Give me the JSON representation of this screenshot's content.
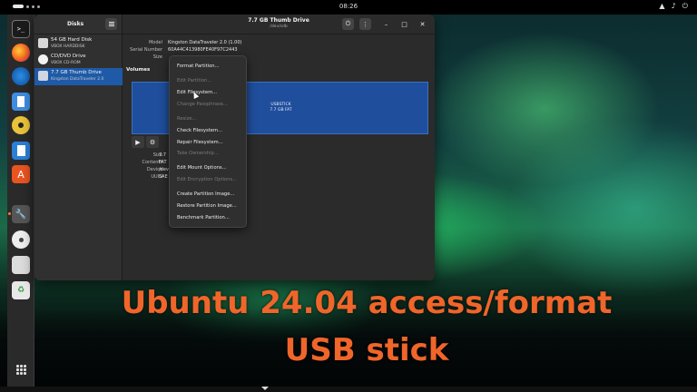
{
  "topbar": {
    "clock": "08:26",
    "tray_icons": [
      "network-icon",
      "volume-icon",
      "power-icon"
    ]
  },
  "dock": {
    "items": [
      "terminal-icon",
      "firefox-icon",
      "thunderbird-icon",
      "notes-icon",
      "rhythmbox-icon",
      "writer-icon",
      "app-center-icon",
      "disks-icon",
      "optical-disc-icon",
      "drive-icon",
      "trash-icon"
    ],
    "active": "disks-icon"
  },
  "sidebar": {
    "title": "Disks",
    "drives": [
      {
        "name": "54 GB Hard Disk",
        "sub": "VBOX HARDDISK"
      },
      {
        "name": "CD/DVD Drive",
        "sub": "VBOX CD-ROM"
      },
      {
        "name": "7.7 GB Thumb Drive",
        "sub": "Kingston DataTraveler 2.0"
      }
    ]
  },
  "window": {
    "title": "7.7 GB Thumb Drive",
    "subtitle": "/dev/sdb"
  },
  "drive_info": {
    "model_label": "Model",
    "model_value": "Kingston DataTraveler 2.0 (1.00)",
    "serial_label": "Serial Number",
    "serial_value": "60A44C413980FE40F97C2443",
    "size_label": "Size"
  },
  "volumes": {
    "title": "Volumes",
    "name": "USBSTICK",
    "size": "7.7 GB FAT"
  },
  "partition_info": {
    "size_label": "Size",
    "size_value": "7.7",
    "contents_label": "Contents",
    "contents_value": "FAT",
    "device_label": "Device",
    "device_value": "/dev",
    "uuid_label": "UUID",
    "uuid_value": "5AE"
  },
  "context_menu": {
    "items": [
      {
        "label": "Format Partition...",
        "enabled": true
      },
      {
        "label": "Edit Partition...",
        "enabled": false
      },
      {
        "label": "Edit Filesystem...",
        "enabled": true
      },
      {
        "label": "Change Passphrase...",
        "enabled": false
      },
      {
        "label": "Resize...",
        "enabled": false
      },
      {
        "label": "Check Filesystem...",
        "enabled": true
      },
      {
        "label": "Repair Filesystem...",
        "enabled": true
      },
      {
        "label": "Take Ownership...",
        "enabled": false
      },
      {
        "label": "Edit Mount Options...",
        "enabled": true
      },
      {
        "label": "Edit Encryption Options...",
        "enabled": false
      },
      {
        "label": "Create Partition Image...",
        "enabled": true
      },
      {
        "label": "Restore Partition Image...",
        "enabled": true
      },
      {
        "label": "Benchmark Partition...",
        "enabled": true
      }
    ]
  },
  "overlay": {
    "line1": "Ubuntu 24.04 access/format",
    "line2": "USB stick",
    "color": "#f0652a"
  }
}
